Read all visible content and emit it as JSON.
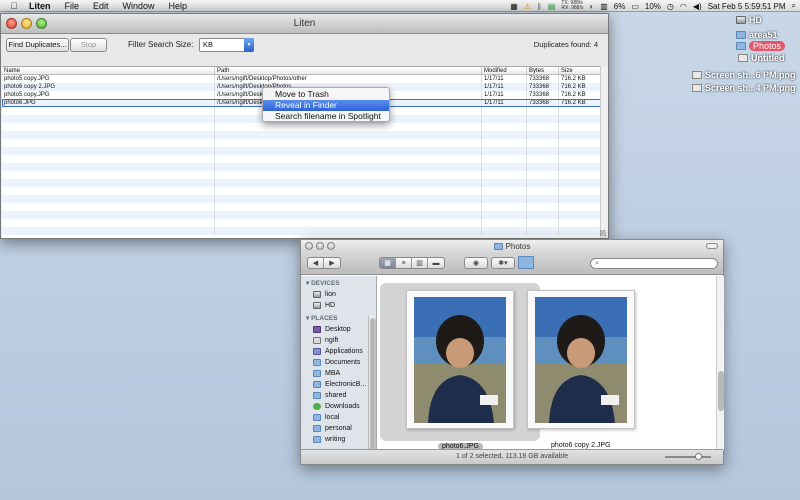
{
  "menubar": {
    "apple": "",
    "app_name": "Liten",
    "menus": [
      "File",
      "Edit",
      "Window",
      "Help"
    ],
    "battery": "6%",
    "volume_level": "10%",
    "clock": "Sat Feb 5  5:59:51 PM",
    "net_up": "TX: 988/s",
    "net_down": "RX: 988/s"
  },
  "desktop": {
    "items": [
      {
        "label": "HD"
      },
      {
        "label": "area51"
      },
      {
        "label": "Photos"
      },
      {
        "label": "Untitled"
      },
      {
        "label": "Screen sh...6 PM.png"
      },
      {
        "label": "Screen sh...4 PM.png"
      }
    ]
  },
  "liten": {
    "title": "Liten",
    "find_button": "Find Duplicates...",
    "stop_button": "Stop",
    "filter_label": "Filter Search Size:",
    "filter_value": "KB",
    "dup_found": "Duplicates found: 4",
    "columns": [
      "Name",
      "Path",
      "Modified",
      "Bytes",
      "Size"
    ],
    "rows": [
      {
        "name": "photo5 copy.JPG",
        "path": "/Users/ngift/Desktop/Photos/other",
        "modified": "1/17/11",
        "bytes": "733368",
        "size": "716.2 KB"
      },
      {
        "name": "photo6 copy 2.JPG",
        "path": "/Users/ngift/Desktop/Photos",
        "modified": "1/17/11",
        "bytes": "733368",
        "size": "716.2 KB"
      },
      {
        "name": "photo5 copy.JPG",
        "path": "/Users/ngift/Desktop/Photos/other",
        "modified": "1/17/11",
        "bytes": "733368",
        "size": "716.2 KB"
      },
      {
        "name": "photo6.JPG",
        "path": "/Users/ngift/Deskt",
        "modified": "1/17/11",
        "bytes": "733368",
        "size": "716.2 KB"
      }
    ]
  },
  "context_menu": {
    "items": [
      "Move to Trash",
      "Reveal in Finder",
      "Search filename in Spotlight"
    ]
  },
  "finder": {
    "title": "Photos",
    "search_placeholder": "",
    "sidebar": {
      "devices_header": "DEVICES",
      "devices": [
        "lion",
        "HD"
      ],
      "places_header": "PLACES",
      "places": [
        "Desktop",
        "ngift",
        "Applications",
        "Documents",
        "MBA",
        "ElectronicB...",
        "shared",
        "Downloads",
        "local",
        "personal",
        "writing"
      ]
    },
    "files": [
      {
        "name": "photo6.JPG"
      },
      {
        "name": "photo6 copy 2.JPG"
      }
    ],
    "status": "1 of 2 selected, 113.18 GB available"
  },
  "colors": {
    "selection_blue": "#2d62d6",
    "row_alt": "#edf3fe",
    "desktop_bg": "#c3d3e5"
  }
}
